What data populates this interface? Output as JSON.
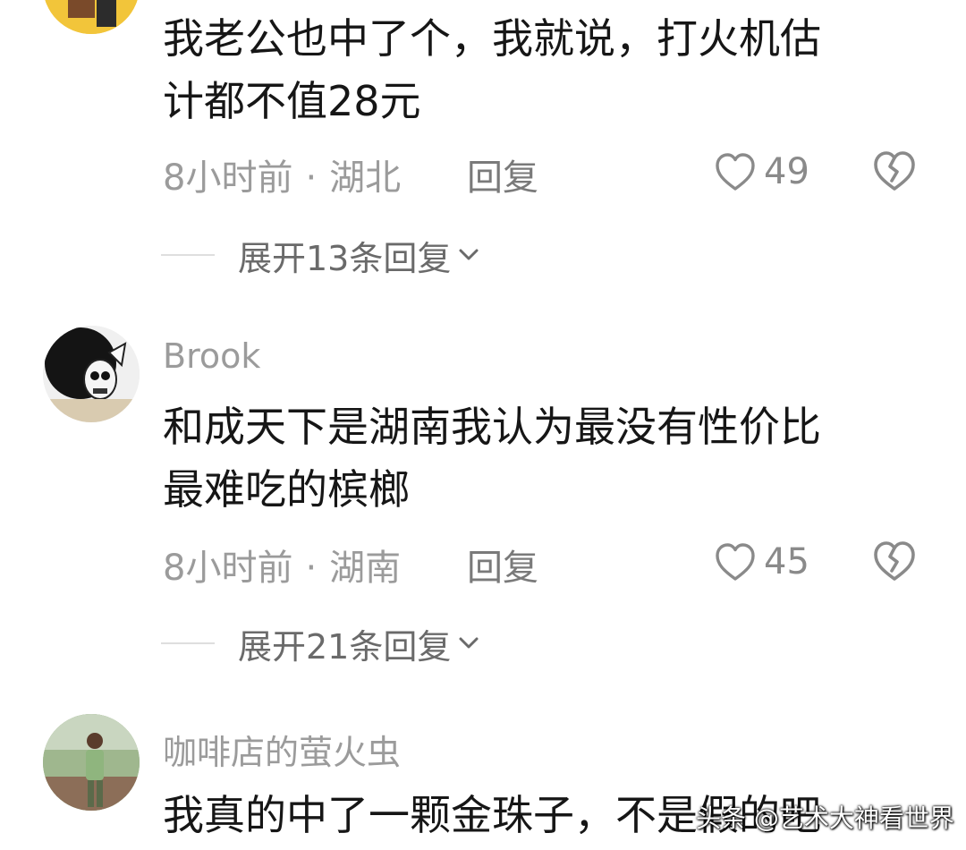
{
  "comments": [
    {
      "username": "",
      "text_lines": [
        "我老公也中了个，我就说，打火机估",
        "计都不值28元"
      ],
      "time": "8小时前",
      "location": "湖北",
      "reply_label": "回复",
      "likes": "49",
      "expand_label": "展开13条回复"
    },
    {
      "username": "Brook",
      "text_lines": [
        "和成天下是湖南我认为最没有性价比",
        "最难吃的槟榔"
      ],
      "time": "8小时前",
      "location": "湖南",
      "reply_label": "回复",
      "likes": "45",
      "expand_label": "展开21条回复"
    },
    {
      "username": "咖啡店的萤火虫",
      "text_lines": [
        "我真的中了一颗金珠子，不是假的吧"
      ]
    }
  ],
  "meta_separator": "·",
  "watermark": "头条 @艺术大神看世界",
  "icons": {
    "like": "heart-outline-icon",
    "dislike": "broken-heart-icon",
    "expand": "chevron-down-icon"
  }
}
